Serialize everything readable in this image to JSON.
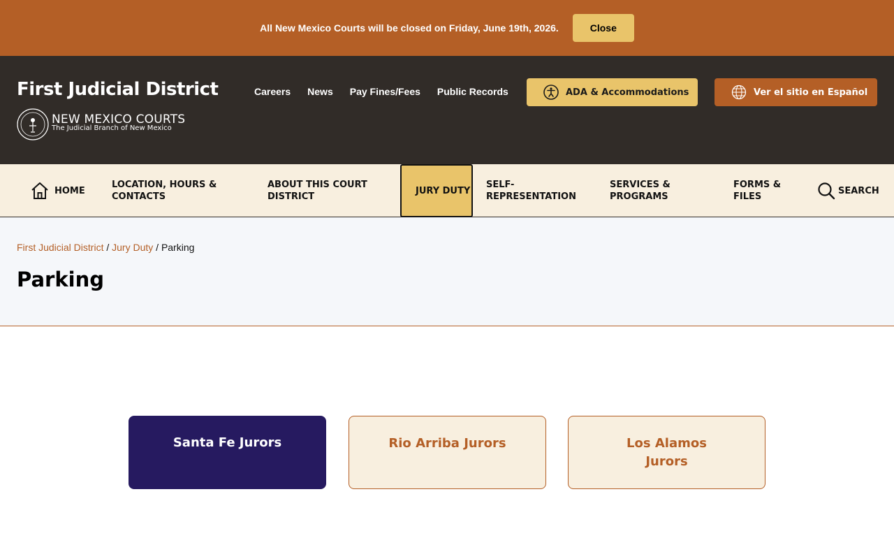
{
  "alert": {
    "message": "All New Mexico Courts will be closed on Friday, June 19th, 2026.",
    "close_label": "Close"
  },
  "header": {
    "site_title": "First Judicial District",
    "brand_name": "NEW MEXICO COURTS",
    "brand_tagline": "The Judicial Branch of New Mexico",
    "utility_links": [
      "Careers",
      "News",
      "Pay Fines/Fees",
      "Public Records"
    ],
    "ada_label": "ADA & Accommodations",
    "spanish_label": "Ver el sitio en Español"
  },
  "nav": {
    "home": "HOME",
    "location": "LOCATION, HOURS & CONTACTS",
    "about": "ABOUT THIS COURT DISTRICT",
    "jury": "JURY DUTY",
    "self_rep": "SELF-REPRESENTATION",
    "services": "SERVICES & PROGRAMS",
    "forms": "FORMS & FILES",
    "search": "SEARCH"
  },
  "breadcrumb": {
    "items": [
      "First Judicial District",
      "Jury Duty"
    ],
    "current": "Parking",
    "separator": "/"
  },
  "page": {
    "title": "Parking"
  },
  "cards": [
    "Santa Fe Jurors",
    "Rio Arriba Jurors",
    "Los Alamos Jurors"
  ],
  "colors": {
    "brand_orange": "#b45f26",
    "accent_gold": "#e9c46a",
    "header_dark": "#312c28",
    "nav_cream": "#f8efdf",
    "active_card": "#261a60"
  }
}
